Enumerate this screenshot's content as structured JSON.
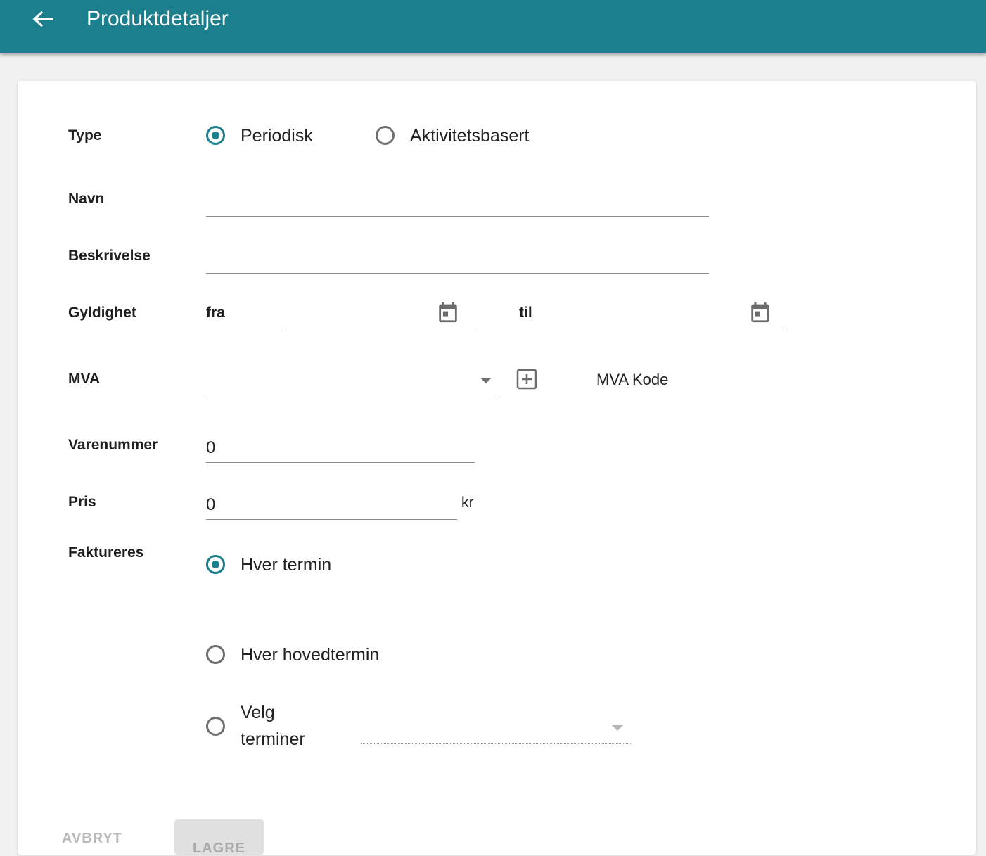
{
  "appbar": {
    "title": "Produktdetaljer",
    "back_icon": "arrow-left-icon"
  },
  "form": {
    "type": {
      "label": "Type",
      "options": [
        {
          "label": "Periodisk",
          "checked": true
        },
        {
          "label": "Aktivitetsbasert",
          "checked": false
        }
      ]
    },
    "navn": {
      "label": "Navn",
      "value": ""
    },
    "beskrivelse": {
      "label": "Beskrivelse",
      "value": ""
    },
    "gyldighet": {
      "label": "Gyldighet",
      "from_label": "fra",
      "to_label": "til",
      "from_value": "",
      "to_value": ""
    },
    "mva": {
      "label": "MVA",
      "selected": "",
      "add_icon": "plus-box-icon",
      "kode_label": "MVA Kode"
    },
    "varenummer": {
      "label": "Varenummer",
      "value": "0"
    },
    "pris": {
      "label": "Pris",
      "value": "0",
      "unit": "kr"
    },
    "faktureres": {
      "label": "Faktureres",
      "options": [
        {
          "label": "Hver termin",
          "checked": true
        },
        {
          "label": "Hver hovedtermin",
          "checked": false
        },
        {
          "label_line1": "Velg",
          "label_line2": "terminer",
          "checked": false
        }
      ],
      "terminer_selected": ""
    }
  },
  "actions": {
    "cancel_label": "AVBRYT",
    "save_label": "LAGRE"
  },
  "colors": {
    "primary": "#1b7f8e",
    "background": "#f1f1f1"
  }
}
